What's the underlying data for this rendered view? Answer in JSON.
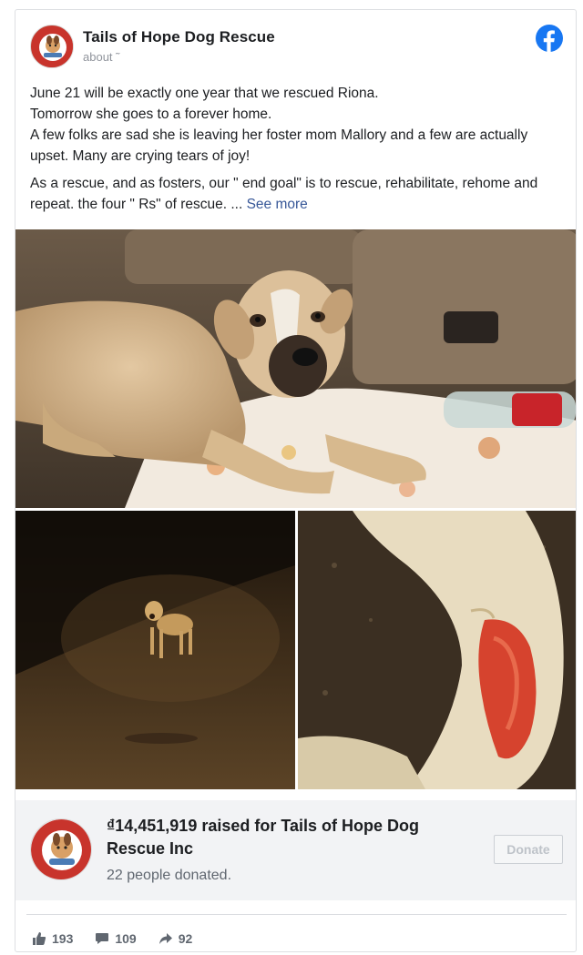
{
  "page": {
    "name": "Tails of Hope Dog Rescue",
    "timestamp": "about ˜",
    "social_icon": "facebook-icon",
    "brand_color": "#1877f2"
  },
  "post": {
    "line1": "June 21 will be exactly one year that we rescued Riona.",
    "line2": "Tomorrow she goes to a forever home.",
    "line3": "A few folks are sad she is leaving her foster mom Mallory and a few are actually upset. Many are crying tears of joy!",
    "paragraph2": "As a rescue, and as fosters, our \" end goal\" is to rescue, rehabilitate, rehome and repeat. the four \" Rs\" of rescue. ...",
    "see_more": "See more"
  },
  "fundraiser": {
    "title": "₫14,451,919 raised for Tails of Hope Dog Rescue Inc",
    "donors": "22 people donated.",
    "donate_label": "Donate"
  },
  "stats": {
    "likes": "193",
    "comments": "109",
    "shares": "92"
  }
}
